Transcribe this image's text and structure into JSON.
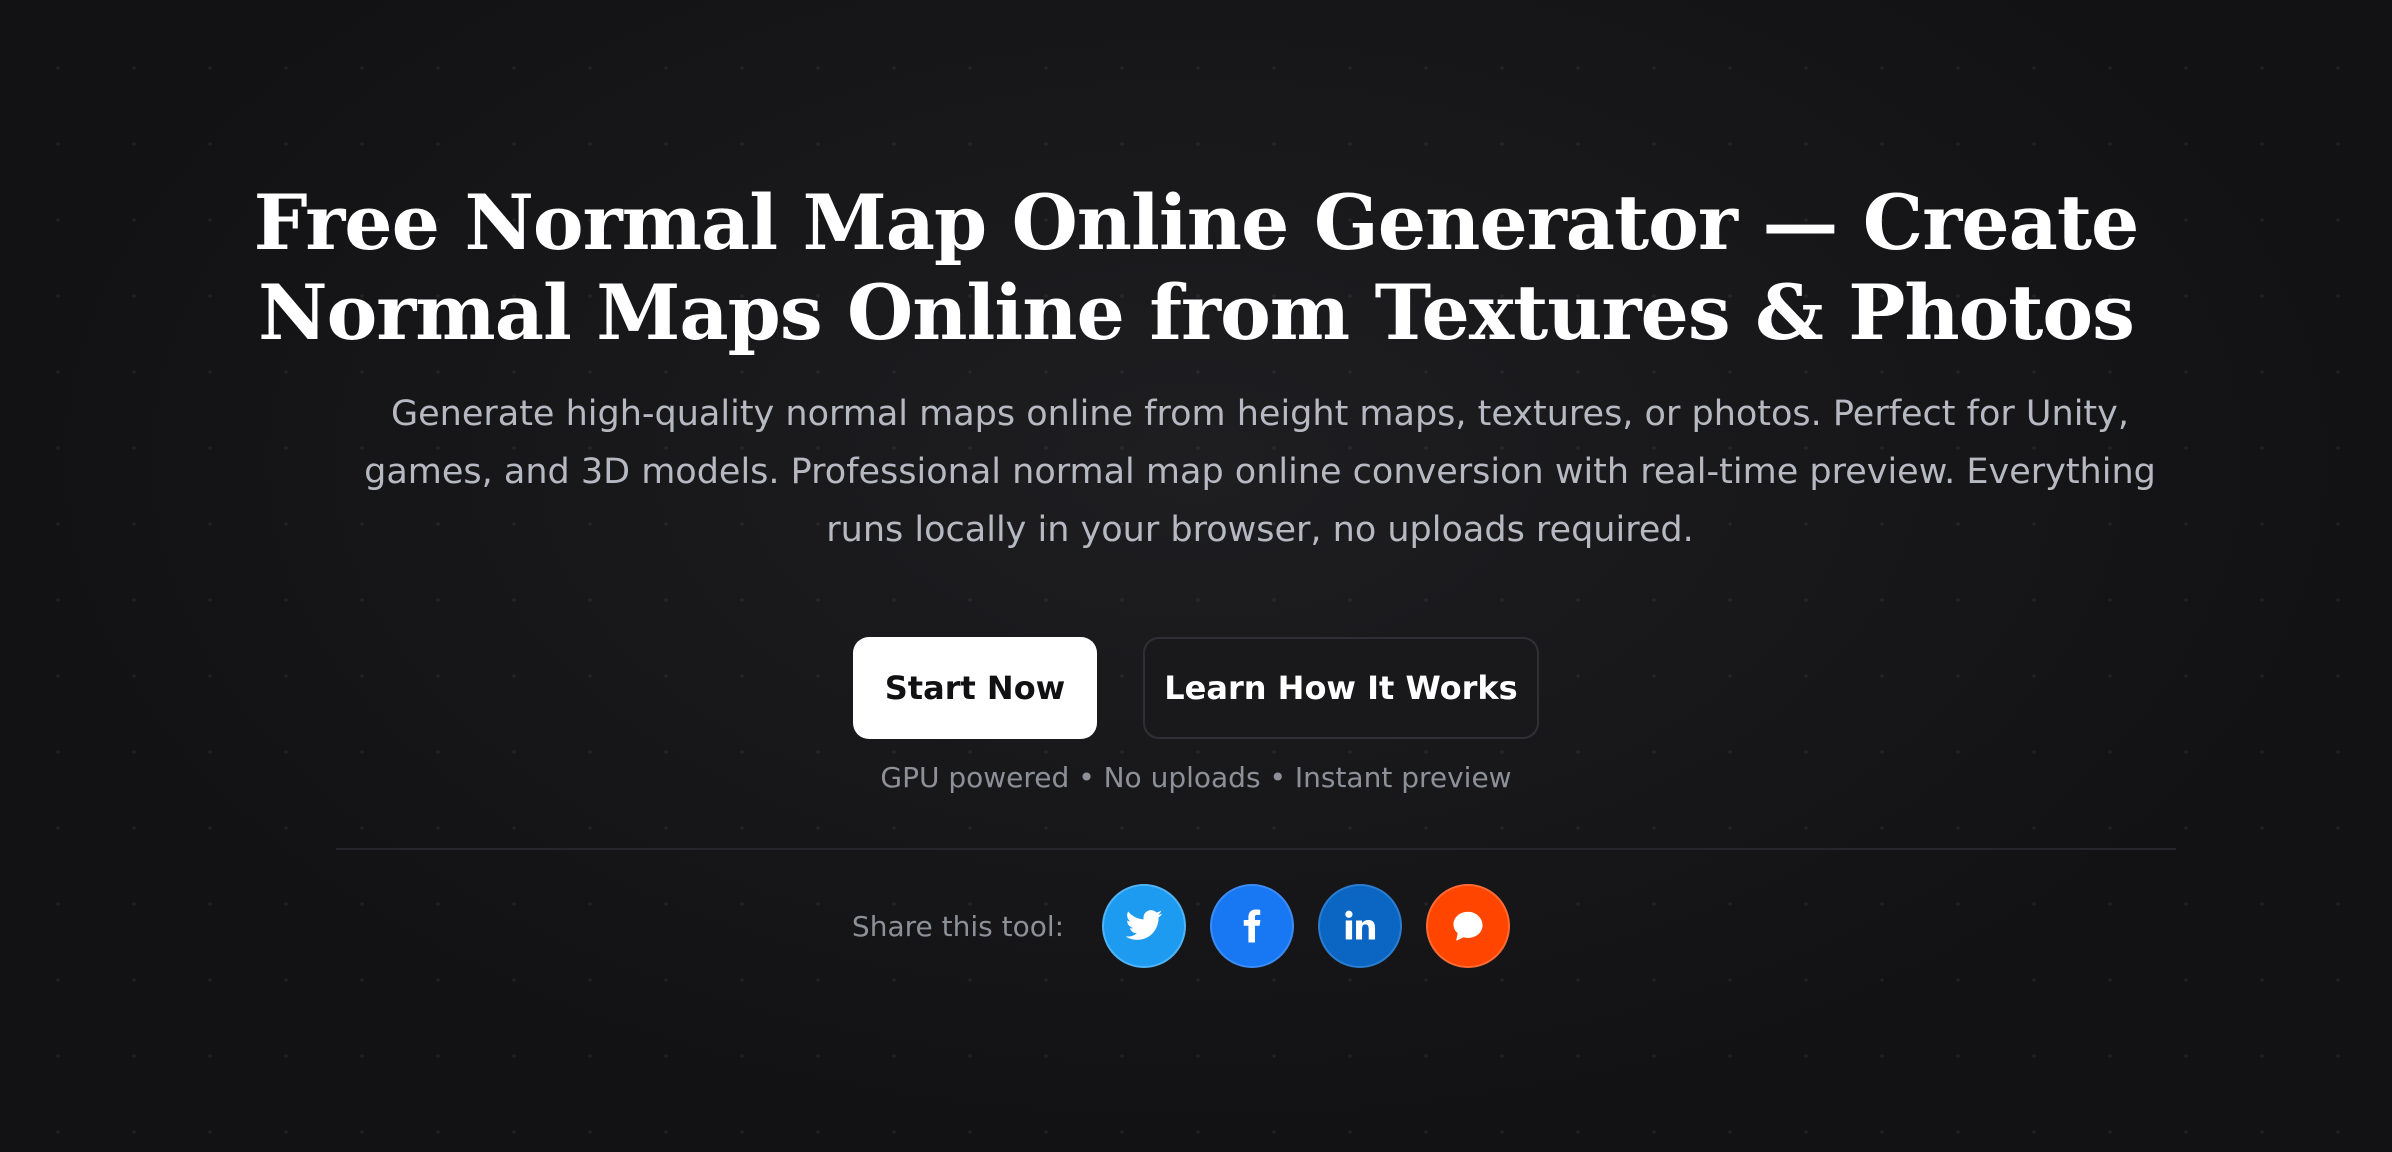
{
  "hero": {
    "title_line1": "Free Normal Map Online Generator — Create",
    "title_line2": "Normal Maps Online from Textures & Photos",
    "subtitle": "Generate high-quality normal maps online from height maps, textures, or photos. Perfect for Unity, games, and 3D models. Professional normal map online conversion with real-time preview. Everything runs locally in your browser, no uploads required."
  },
  "cta": {
    "primary_label": "Start Now",
    "secondary_label": "Learn How It Works"
  },
  "features_text": "GPU powered • No uploads • Instant preview",
  "share": {
    "label": "Share this tool:",
    "buttons": [
      {
        "name": "twitter",
        "icon": "twitter-icon",
        "color": "#1d9bf0"
      },
      {
        "name": "facebook",
        "icon": "facebook-icon",
        "color": "#1877f2"
      },
      {
        "name": "linkedin",
        "icon": "linkedin-icon",
        "color": "#0a66c2"
      },
      {
        "name": "reddit",
        "icon": "reddit-icon",
        "color": "#ff4500"
      }
    ]
  },
  "colors": {
    "background": "#121214",
    "title": "#ffffff",
    "subtitle": "#b7b9c2",
    "muted": "#8e9099"
  }
}
